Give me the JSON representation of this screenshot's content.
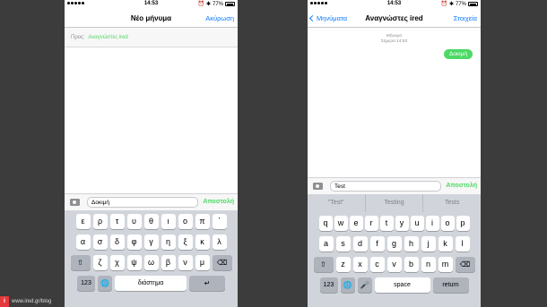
{
  "left_phone": {
    "status": {
      "time": "14:53",
      "battery": "77%"
    },
    "nav": {
      "title": "Νέο μήνυμα",
      "right": "Ακύρωση"
    },
    "to": {
      "label": "Προς:",
      "value": "Αναγνώστες ired"
    },
    "compose": {
      "text": "Δοκιμή",
      "send": "Αποστολή"
    },
    "keyboard": {
      "row1": [
        "ε",
        "ρ",
        "τ",
        "υ",
        "θ",
        "ι",
        "ο",
        "π",
        "΄"
      ],
      "row2": [
        "α",
        "σ",
        "δ",
        "φ",
        "γ",
        "η",
        "ξ",
        "κ",
        "λ"
      ],
      "row3": [
        "ζ",
        "χ",
        "ψ",
        "ω",
        "β",
        "ν",
        "μ"
      ],
      "numbers": "123",
      "space": "διάστημα"
    }
  },
  "right_phone": {
    "status": {
      "time": "14:53",
      "battery": "77%"
    },
    "nav": {
      "back": "Μηνύματα",
      "title": "Αναγνώστες ired",
      "right": "Στοιχεία"
    },
    "meta": {
      "line1": "Μήνυμα",
      "line2": "Σήμερα 14:53"
    },
    "bubble": "Δοκιμή",
    "compose": {
      "text": "Test",
      "send": "Αποστολή"
    },
    "predictions": [
      "\"Test\"",
      "Testing",
      "Tests"
    ],
    "keyboard": {
      "row1": [
        "q",
        "w",
        "e",
        "r",
        "t",
        "y",
        "u",
        "i",
        "o",
        "p"
      ],
      "row2": [
        "a",
        "s",
        "d",
        "f",
        "g",
        "h",
        "j",
        "k",
        "l"
      ],
      "row3": [
        "z",
        "x",
        "c",
        "v",
        "b",
        "n",
        "m"
      ],
      "numbers": "123",
      "space": "space",
      "return": "return"
    }
  },
  "watermark": {
    "logo": "i",
    "text": "www.ired.gr/blog"
  }
}
